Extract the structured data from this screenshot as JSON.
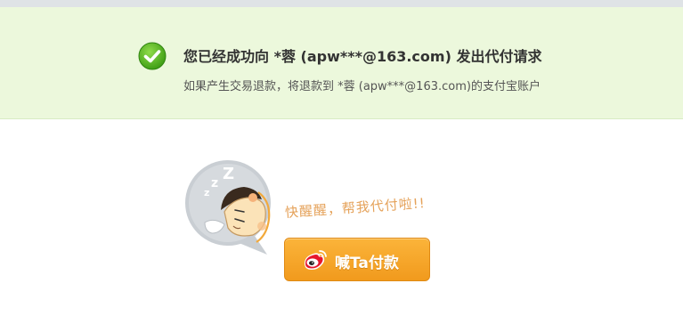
{
  "notice": {
    "title": "您已经成功向 *蓉 (apw***@163.com) 发出代付请求",
    "subtitle": "如果产生交易退款，将退款到 *蓉 (apw***@163.com)的支付宝账户",
    "background_color": "#ecf8dc",
    "icon": "check-circle-icon"
  },
  "reminder": {
    "text": "快醒醒，帮我代付啦!!",
    "illustration": "sleeping-person-icon"
  },
  "call_button": {
    "label": "喊Ta付款",
    "icon": "weibo-icon",
    "color": "#f5a623"
  }
}
